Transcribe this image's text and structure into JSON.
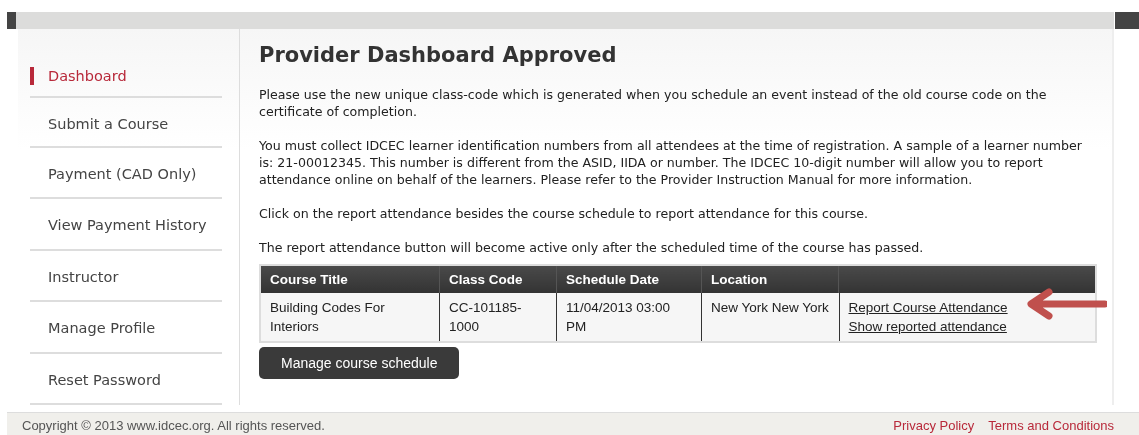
{
  "sidebar": {
    "items": [
      {
        "label": "Dashboard",
        "selected": true
      },
      {
        "label": "Submit a Course",
        "selected": false
      },
      {
        "label": "Payment (CAD Only)",
        "selected": false
      },
      {
        "label": "View Payment History",
        "selected": false
      },
      {
        "label": "Instructor",
        "selected": false
      },
      {
        "label": "Manage Profile",
        "selected": false
      },
      {
        "label": "Reset Password",
        "selected": false
      }
    ]
  },
  "main": {
    "title": "Provider Dashboard Approved",
    "paragraphs": [
      "Please use the new unique class-code which is generated when you schedule an event instead of the old course code on the certificate of completion.",
      "You must collect IDCEC learner identification numbers from all attendees at the time of registration. A sample of a learner number is: 21-00012345. This number is different from the ASID, IIDA or number. The IDCEC 10-digit number will allow you to report attendance online on behalf of the learners. Please refer to the Provider Instruction Manual for more information.",
      "Click on the report attendance besides the course schedule to report attendance for this course.",
      "The report attendance button will become active only after the scheduled time of the course has passed."
    ],
    "table": {
      "columns": [
        "Course Title",
        "Class Code",
        "Schedule Date",
        "Location",
        ""
      ],
      "rows": [
        {
          "course_title": "Building Codes For Interiors",
          "class_code": "CC-101185-1000",
          "schedule_date": "11/04/2013 03:00 PM",
          "location": "New York New York",
          "links": [
            "Report Course Attendance",
            "Show reported attendance"
          ]
        }
      ]
    },
    "button": "Manage course schedule"
  },
  "footer": {
    "copyright": "Copyright © 2013 www.idcec.org. All rights reserved.",
    "links": [
      "Privacy Policy",
      "Terms and Conditions"
    ]
  }
}
